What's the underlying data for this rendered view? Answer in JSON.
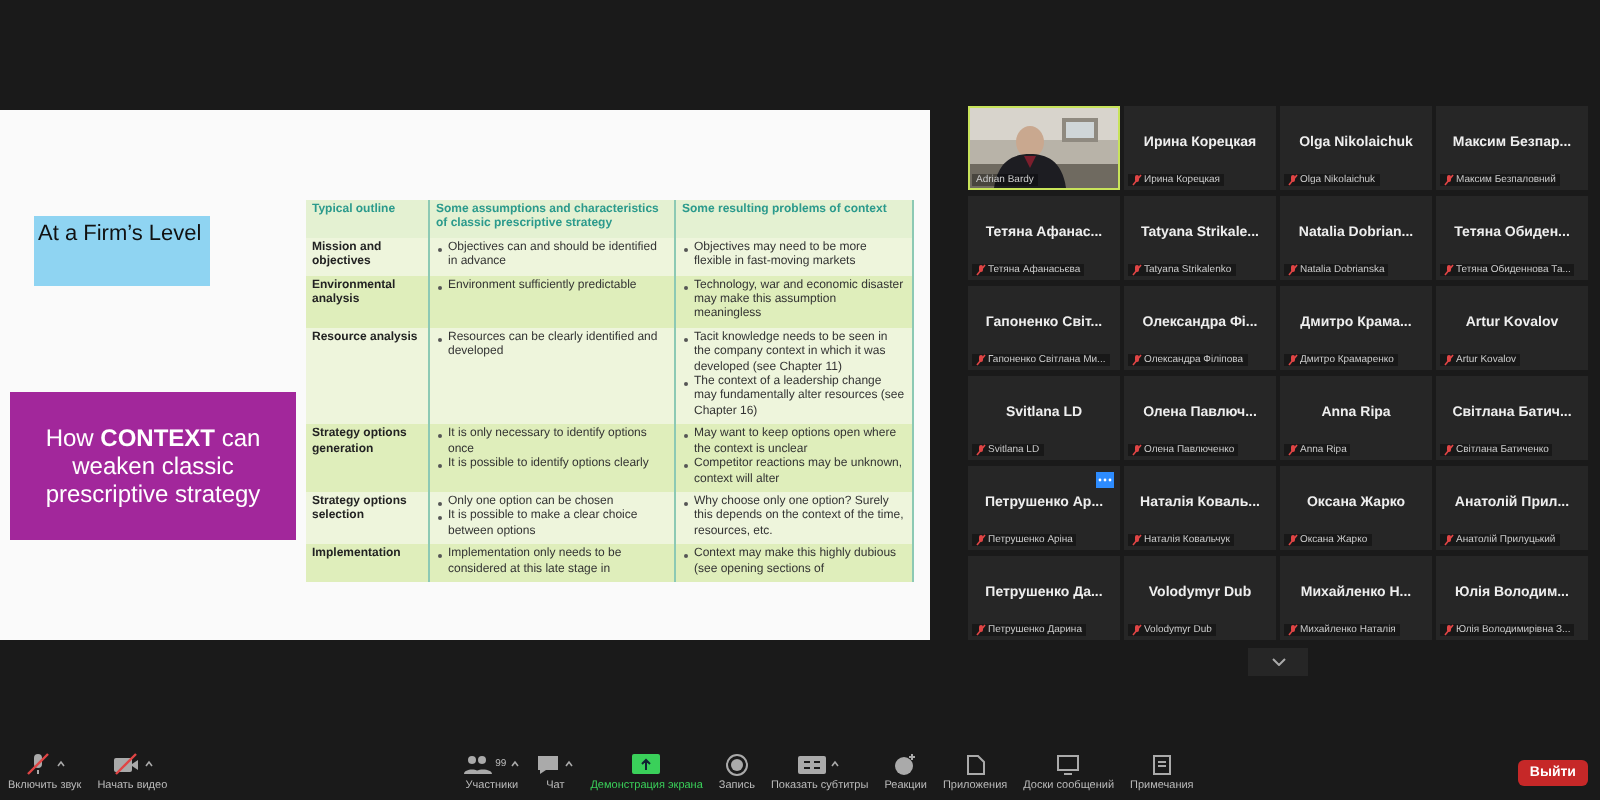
{
  "slide": {
    "firm_level": "At a Firm’s Level",
    "context_title": "How **CONTEXT** can weaken classic prescriptive strategy",
    "table": {
      "columns": [
        "Typical outline",
        "Some assumptions and characteristics of classic prescriptive strategy",
        "Some resulting problems of context"
      ],
      "rows": [
        {
          "outline": "Mission and objectives",
          "assumptions": [
            "Objectives can and should be identified in advance"
          ],
          "problems": [
            "Objectives may need to be more flexible in fast-moving markets"
          ]
        },
        {
          "outline": "Environmental analysis",
          "assumptions": [
            "Environment sufficiently predictable"
          ],
          "problems": [
            "Technology, war and economic disaster may make this assumption meaningless"
          ]
        },
        {
          "outline": "Resource analysis",
          "assumptions": [
            "Resources can be clearly identified and developed"
          ],
          "problems": [
            "Tacit knowledge needs to be seen in the company context in which it was developed (see Chapter 11)",
            "The context of a leadership change may fundamentally alter resources (see Chapter 16)"
          ]
        },
        {
          "outline": "Strategy options generation",
          "assumptions": [
            "It is only necessary to identify options once",
            "It is possible to identify options clearly"
          ],
          "problems": [
            "May want to keep options open where the context is unclear",
            "Competitor reactions may be unknown, context will alter"
          ]
        },
        {
          "outline": "Strategy options selection",
          "assumptions": [
            "Only one option can be chosen",
            "It is possible to make a clear choice between options"
          ],
          "problems": [
            "Why choose only one option? Surely this depends on the context of the time, resources, etc."
          ]
        },
        {
          "outline": "Implementation",
          "assumptions": [
            "Implementation only needs to be considered at this late stage in"
          ],
          "problems": [
            "Context may make this highly dubious (see opening sections of"
          ]
        }
      ]
    }
  },
  "participants": [
    {
      "kind": "video",
      "label": "Adrian Bardy",
      "muted": false,
      "speaking": true,
      "menu": false
    },
    {
      "kind": "name",
      "name": "Ирина Корецкая",
      "label": "Ирина Корецкая",
      "muted": true,
      "speaking": false,
      "menu": false
    },
    {
      "kind": "name",
      "name": "Olga Nikolaichuk",
      "label": "Olga Nikolaichuk",
      "muted": true,
      "speaking": false,
      "menu": false
    },
    {
      "kind": "name",
      "name": "Максим Безпар...",
      "label": "Максим Безпаловний",
      "muted": true,
      "speaking": false,
      "menu": false
    },
    {
      "kind": "name",
      "name": "Тетяна Афанас...",
      "label": "Тетяна Афанасьєва",
      "muted": true,
      "speaking": false,
      "menu": false
    },
    {
      "kind": "name",
      "name": "Tatyana Strikale...",
      "label": "Tatyana Strikalenko",
      "muted": true,
      "speaking": false,
      "menu": false
    },
    {
      "kind": "name",
      "name": "Natalia Dobrian...",
      "label": "Natalia Dobrianska",
      "muted": true,
      "speaking": false,
      "menu": false
    },
    {
      "kind": "name",
      "name": "Тетяна Обиден...",
      "label": "Тетяна Обиденнова Та...",
      "muted": true,
      "speaking": false,
      "menu": false
    },
    {
      "kind": "name",
      "name": "Гапоненко Світ...",
      "label": "Гапоненко Світлана Ми...",
      "muted": true,
      "speaking": false,
      "menu": false
    },
    {
      "kind": "name",
      "name": "Олександра Фі...",
      "label": "Олександра Філіпова",
      "muted": true,
      "speaking": false,
      "menu": false
    },
    {
      "kind": "name",
      "name": "Дмитро Крама...",
      "label": "Дмитро Крамаренко",
      "muted": true,
      "speaking": false,
      "menu": false
    },
    {
      "kind": "name",
      "name": "Artur Kovalov",
      "label": "Artur Kovalov",
      "muted": true,
      "speaking": false,
      "menu": false
    },
    {
      "kind": "name",
      "name": "Svitlana LD",
      "label": "Svitlana LD",
      "muted": true,
      "speaking": false,
      "menu": false
    },
    {
      "kind": "name",
      "name": "Олена Павлюч...",
      "label": "Олена Павлюченко",
      "muted": true,
      "speaking": false,
      "menu": false
    },
    {
      "kind": "name",
      "name": "Anna Ripa",
      "label": "Anna Ripa",
      "muted": true,
      "speaking": false,
      "menu": false
    },
    {
      "kind": "name",
      "name": "Світлана Батич...",
      "label": "Світлана Батиченко",
      "muted": true,
      "speaking": false,
      "menu": false
    },
    {
      "kind": "name",
      "name": "Петрушенко Ар...",
      "label": "Петрушенко Аріна",
      "muted": true,
      "speaking": false,
      "menu": true
    },
    {
      "kind": "name",
      "name": "Наталія Коваль...",
      "label": "Наталія Ковальчук",
      "muted": true,
      "speaking": false,
      "menu": false
    },
    {
      "kind": "name",
      "name": "Оксана Жарко",
      "label": "Оксана Жарко",
      "muted": true,
      "speaking": false,
      "menu": false
    },
    {
      "kind": "name",
      "name": "Анатолій Прил...",
      "label": "Анатолій Прилуцький",
      "muted": true,
      "speaking": false,
      "menu": false
    },
    {
      "kind": "name",
      "name": "Петрушенко Да...",
      "label": "Петрушенко Дарина",
      "muted": true,
      "speaking": false,
      "menu": false
    },
    {
      "kind": "name",
      "name": "Volodymyr Dub",
      "label": "Volodymyr Dub",
      "muted": true,
      "speaking": false,
      "menu": false
    },
    {
      "kind": "name",
      "name": "Михайленко Н...",
      "label": "Михайленко Наталія",
      "muted": true,
      "speaking": false,
      "menu": false
    },
    {
      "kind": "name",
      "name": "Юлія Володим...",
      "label": "Юлія Володимирівна З...",
      "muted": true,
      "speaking": false,
      "menu": false
    }
  ],
  "toolbar": {
    "left": [
      {
        "kind": "mic",
        "label": "Включить звук",
        "off": true,
        "caret": true,
        "active": false
      },
      {
        "kind": "video",
        "label": "Начать видео",
        "off": true,
        "caret": true,
        "active": false
      }
    ],
    "center": [
      {
        "kind": "participants",
        "label": "Участники",
        "count": "99",
        "off": false,
        "caret": true,
        "active": false
      },
      {
        "kind": "chat",
        "label": "Чат",
        "off": false,
        "caret": true,
        "active": false
      },
      {
        "kind": "share",
        "label": "Демонстрация экрана",
        "off": false,
        "caret": false,
        "active": true
      },
      {
        "kind": "record",
        "label": "Запись",
        "off": false,
        "caret": false,
        "active": false
      },
      {
        "kind": "cc",
        "label": "Показать субтитры",
        "off": false,
        "caret": true,
        "active": false
      },
      {
        "kind": "reactions",
        "label": "Реакции",
        "off": false,
        "caret": false,
        "active": false
      },
      {
        "kind": "apps",
        "label": "Приложения",
        "off": false,
        "caret": false,
        "active": false
      },
      {
        "kind": "whiteboard",
        "label": "Доски сообщений",
        "off": false,
        "caret": false,
        "active": false
      },
      {
        "kind": "notes",
        "label": "Примечания",
        "off": false,
        "caret": false,
        "active": false
      }
    ],
    "leave": "Выйти"
  }
}
